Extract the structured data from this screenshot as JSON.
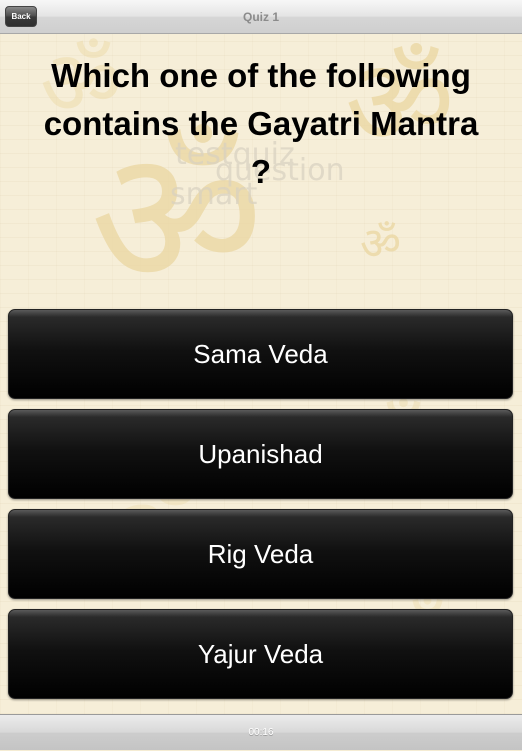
{
  "navbar": {
    "back_label": "Back",
    "title": "Quiz 1"
  },
  "question": {
    "text": "Which one of the following\ncontains the Gayatri Mantra\n?"
  },
  "watermark": {
    "text_lines": [
      "testquiz",
      "question",
      "smart"
    ],
    "om_symbol": "ॐ"
  },
  "answers": [
    {
      "label": "Sama Veda"
    },
    {
      "label": "Upanishad"
    },
    {
      "label": "Rig Veda"
    },
    {
      "label": "Yajur Veda"
    }
  ],
  "toolbar": {
    "timer": "00:16"
  },
  "colors": {
    "background": "#f6eed8",
    "watermark": "#e6cc8e",
    "button": "#000000",
    "button_text": "#ffffff"
  }
}
